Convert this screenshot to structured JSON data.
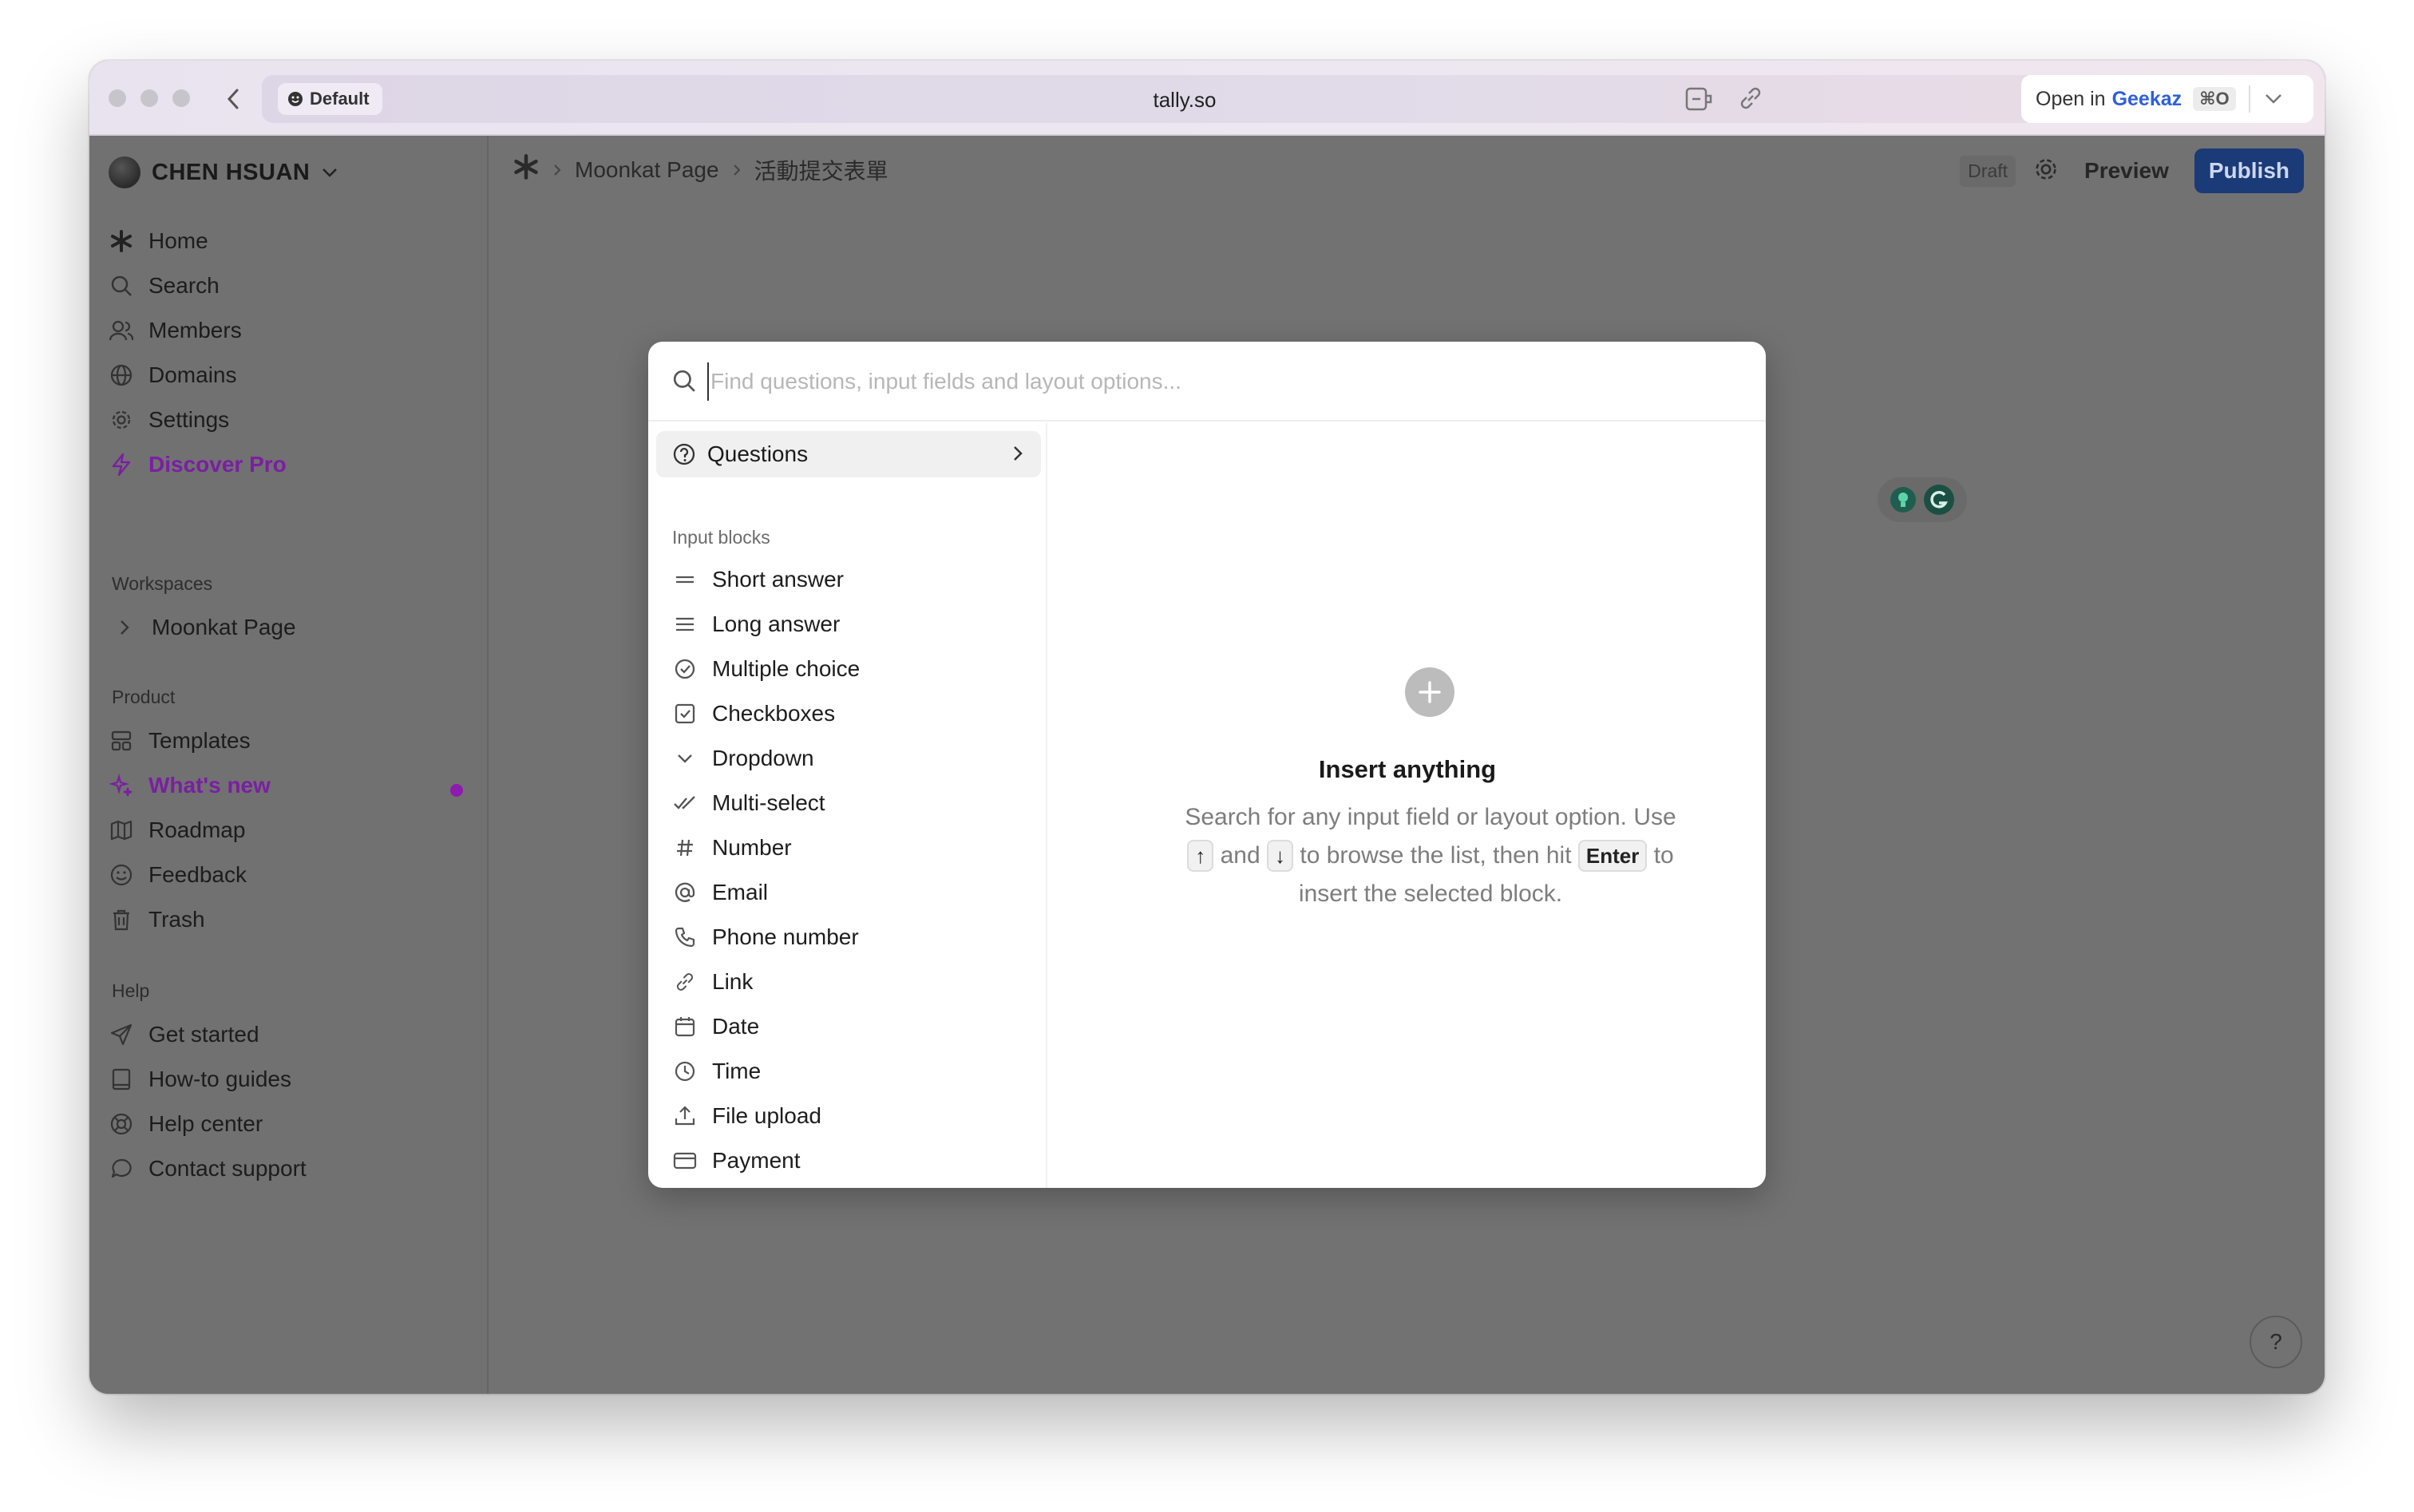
{
  "browser": {
    "profile_label": "Default",
    "url": "tally.so",
    "open_in_prefix": "Open in",
    "open_in_app": "Geekaz",
    "open_in_shortcut": "⌘O"
  },
  "sidebar": {
    "workspace_name": "CHEN HSUAN",
    "nav": [
      {
        "label": "Home",
        "icon": "tally-star-icon"
      },
      {
        "label": "Search",
        "icon": "search-icon"
      },
      {
        "label": "Members",
        "icon": "users-icon"
      },
      {
        "label": "Domains",
        "icon": "globe-icon"
      },
      {
        "label": "Settings",
        "icon": "gear-icon"
      },
      {
        "label": "Discover Pro",
        "icon": "lightning-icon"
      }
    ],
    "workspaces_label": "Workspaces",
    "workspaces": [
      {
        "label": "Moonkat Page"
      }
    ],
    "product_label": "Product",
    "product": [
      {
        "label": "Templates",
        "icon": "templates-icon"
      },
      {
        "label": "What's new",
        "icon": "sparkles-icon"
      },
      {
        "label": "Roadmap",
        "icon": "map-icon"
      },
      {
        "label": "Feedback",
        "icon": "smile-icon"
      },
      {
        "label": "Trash",
        "icon": "trash-icon"
      }
    ],
    "help_label": "Help",
    "help": [
      {
        "label": "Get started",
        "icon": "send-icon"
      },
      {
        "label": "How-to guides",
        "icon": "book-icon"
      },
      {
        "label": "Help center",
        "icon": "lifebuoy-icon"
      },
      {
        "label": "Contact support",
        "icon": "chat-icon"
      }
    ],
    "accent_color": "#7a1fa2"
  },
  "topbar": {
    "breadcrumb": [
      "Moonkat Page",
      "活動提交表單"
    ],
    "draft_label": "Draft",
    "preview_label": "Preview",
    "publish_label": "Publish"
  },
  "modal": {
    "search_placeholder": "Find questions, input fields and layout options...",
    "questions_label": "Questions",
    "input_blocks_label": "Input blocks",
    "blocks": [
      {
        "label": "Short answer",
        "icon": "short-answer-icon"
      },
      {
        "label": "Long answer",
        "icon": "long-answer-icon"
      },
      {
        "label": "Multiple choice",
        "icon": "multiple-choice-icon"
      },
      {
        "label": "Checkboxes",
        "icon": "checkbox-icon"
      },
      {
        "label": "Dropdown",
        "icon": "chevron-down-icon"
      },
      {
        "label": "Multi-select",
        "icon": "double-check-icon"
      },
      {
        "label": "Number",
        "icon": "hash-icon"
      },
      {
        "label": "Email",
        "icon": "at-icon"
      },
      {
        "label": "Phone number",
        "icon": "phone-icon"
      },
      {
        "label": "Link",
        "icon": "link-icon"
      },
      {
        "label": "Date",
        "icon": "calendar-icon"
      },
      {
        "label": "Time",
        "icon": "clock-icon"
      },
      {
        "label": "File upload",
        "icon": "upload-icon"
      },
      {
        "label": "Payment",
        "icon": "credit-card-icon"
      }
    ],
    "insert_title": "Insert anything",
    "desc_1": "Search for any input field or layout option. Use",
    "key_up": "↑",
    "desc_2": "and",
    "key_down": "↓",
    "desc_3": "to browse the list, then hit",
    "key_enter": "Enter",
    "desc_4": "to insert the selected block."
  },
  "help_button_label": "?"
}
